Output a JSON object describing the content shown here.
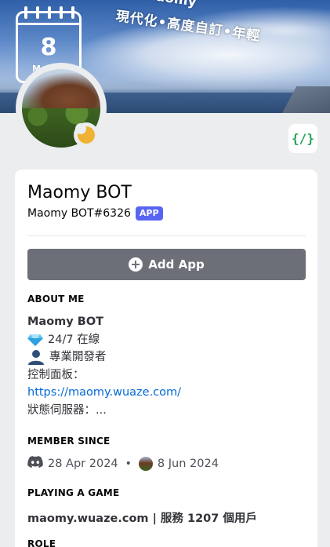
{
  "banner": {
    "brand_text": "Maomy",
    "slogan": "現代化•高度自訂•年輕",
    "calendar": {
      "day": "8",
      "month": "M"
    }
  },
  "profile": {
    "display_name": "Maomy BOT",
    "username": "Maomy BOT#6326",
    "badge": "APP",
    "status": "idle"
  },
  "code_badge": {
    "label": "{/}"
  },
  "actions": {
    "add_app_label": "Add App"
  },
  "about": {
    "heading": "ABOUT ME",
    "title": "Maomy BOT",
    "line1": "24/7 在線",
    "line2": "專業開發者",
    "line3": "控制面板：",
    "link": "https://maomy.wuaze.com/",
    "line4": "狀態伺服器：..."
  },
  "member_since": {
    "heading": "MEMBER SINCE",
    "discord_date": "28 Apr 2024",
    "server_date": "8 Jun 2024",
    "separator": "•"
  },
  "activity": {
    "heading": "PLAYING A GAME",
    "text": "maomy.wuaze.com | 服務 1207 個用戶"
  },
  "role": {
    "heading": "ROLE"
  },
  "colors": {
    "app_badge": "#5865f2",
    "add_button": "#6d6f78",
    "link": "#0468d7",
    "idle_status": "#f0b232",
    "code_icon": "#23a55a"
  }
}
